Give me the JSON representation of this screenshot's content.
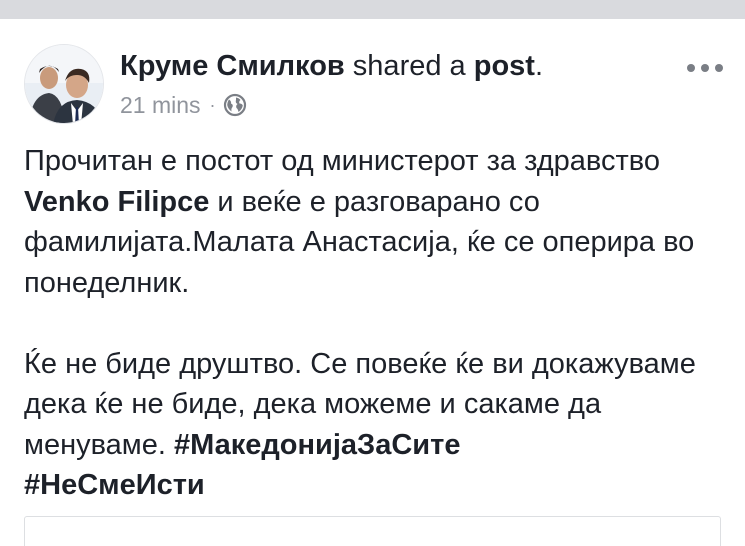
{
  "post": {
    "author_name": "Круме Смилков",
    "shared_text": " shared a ",
    "post_link": "post",
    "period": ".",
    "time": "21 mins",
    "dot": "·",
    "privacy_icon": "globe-icon",
    "more_icon": "more-horizontal-icon",
    "avatar_icon": "profile-photo-avatar"
  },
  "content": {
    "p1_a": "Прочитан е постот од министерот за здравство ",
    "mention": "Venko Filipce",
    "p1_b": " и веќе е разговарано со фамилијата.Малата Анастасија, ќе се оперира во понеделник.",
    "p2_a": "Ќе не биде друштво. Се повеќе ќе ви докажуваме дека ќе не биде, дека можеме и сакаме да менуваме. ",
    "hashtag1": "#МакедонијаЗаСите",
    "hashtag2": "#НеСмеИсти"
  },
  "colors": {
    "top_bar": "#d9dade",
    "text": "#1d2129",
    "meta": "#90949c",
    "border": "#dddfe2"
  }
}
